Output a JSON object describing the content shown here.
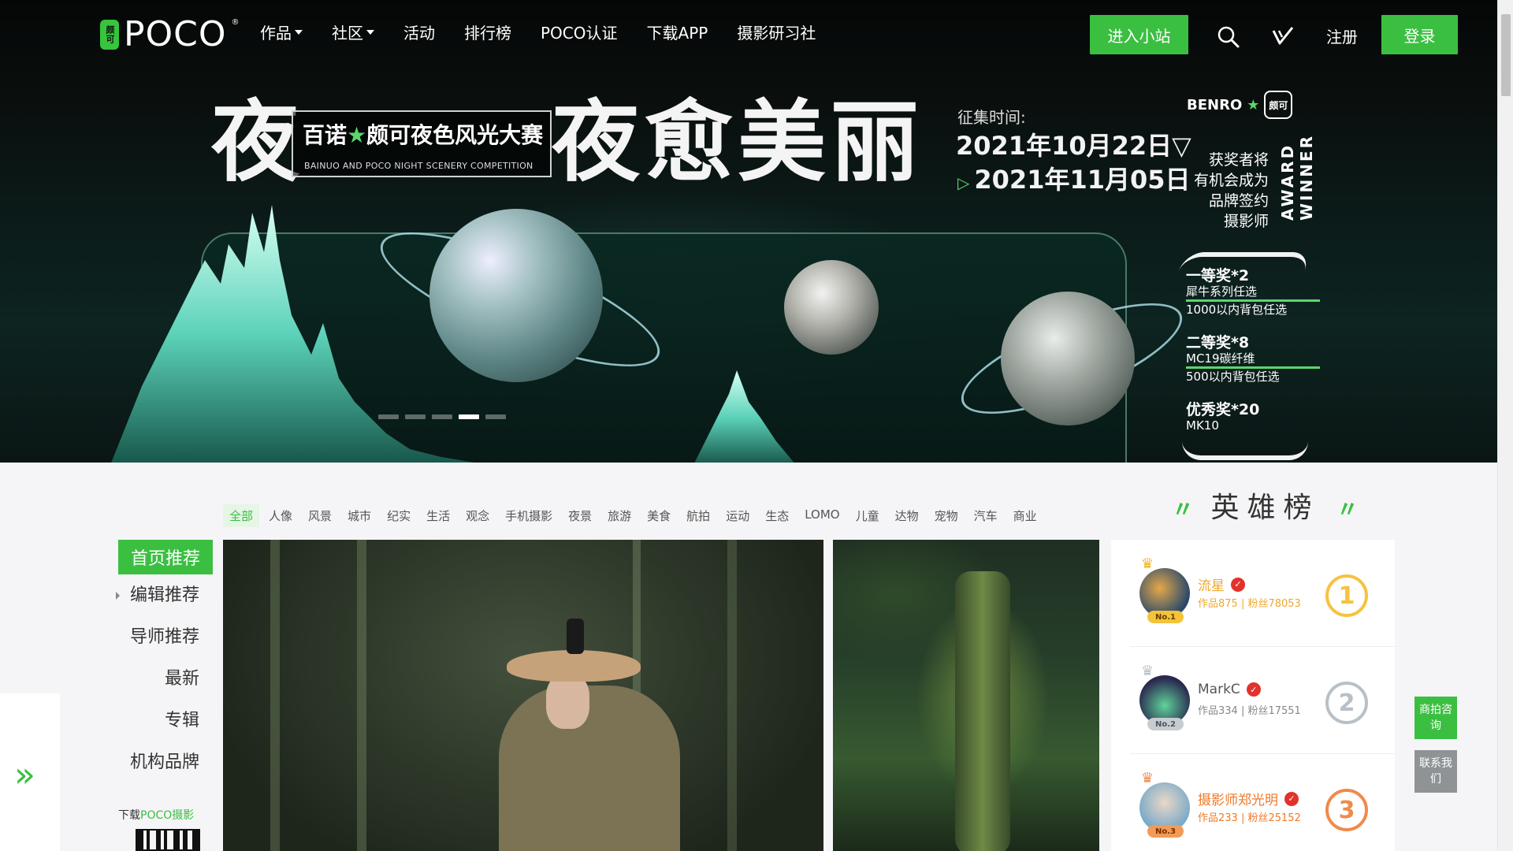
{
  "header": {
    "logo_mark": "颇可",
    "logo_text": "POCO",
    "logo_reg": "®",
    "nav": [
      {
        "label": "作品",
        "has_dropdown": true
      },
      {
        "label": "社区",
        "has_dropdown": true
      },
      {
        "label": "活动",
        "has_dropdown": false
      },
      {
        "label": "排行榜",
        "has_dropdown": false
      },
      {
        "label": "POCO认证",
        "has_dropdown": false
      },
      {
        "label": "下载APP",
        "has_dropdown": false
      },
      {
        "label": "摄影研习社",
        "has_dropdown": false
      }
    ],
    "enter_site": "进入小站",
    "search_icon": "search-icon",
    "check_icon": "check-icon",
    "register": "注册",
    "login": "登录"
  },
  "banner": {
    "title_part1": "夜",
    "title_part2": "夜愈美丽",
    "sub_title_a": "百诺",
    "sub_title_star": "★",
    "sub_title_b": "颇可夜色风光大赛",
    "sub_title_en": "BAINUO AND POCO NIGHT SCENERY COMPETITION",
    "date_label": "征集时间:",
    "date_start": "2021年10月22日▽",
    "date_end_arrow": "▷",
    "date_end": "2021年11月05日",
    "brand": "BENRO",
    "brand_badge": "颇可",
    "winner_lines": [
      "获奖者将",
      "有机会成为",
      "品牌签约",
      "摄影师"
    ],
    "award_winner": "AWARD WINNER",
    "prizes": [
      {
        "name": "一等奖*2",
        "lines": [
          "犀牛系列任选",
          "1000以内背包任选"
        ]
      },
      {
        "name": "二等奖*8",
        "lines": [
          "MC19碳纤维",
          "500以内背包任选"
        ]
      },
      {
        "name": "优秀奖*20",
        "lines": [
          "MK10"
        ]
      }
    ],
    "dots": 5,
    "active_dot": 3
  },
  "categories": [
    "全部",
    "人像",
    "风景",
    "城市",
    "纪实",
    "生活",
    "观念",
    "手机摄影",
    "夜景",
    "旅游",
    "美食",
    "航拍",
    "运动",
    "生态",
    "LOMO",
    "儿童",
    "达物",
    "宠物",
    "汽车",
    "商业"
  ],
  "active_category": "全部",
  "side_menu": {
    "recommend": "首页推荐",
    "items": [
      "编辑推荐",
      "导师推荐",
      "最新",
      "专辑",
      "机构品牌"
    ]
  },
  "download": {
    "prefix": "下载",
    "app": "POCO摄影"
  },
  "hero_board": {
    "title": "英雄榜",
    "quote_left": "〃",
    "quote_right": "〃",
    "items": [
      {
        "name": "流星",
        "stats": "作品875 | 粉丝78053",
        "no": "No.1",
        "rank": "1"
      },
      {
        "name": "MarkC",
        "stats": "作品334 | 粉丝17551",
        "no": "No.2",
        "rank": "2"
      },
      {
        "name": "摄影师郑光明",
        "stats": "作品233 | 粉丝25152",
        "no": "No.3",
        "rank": "3"
      }
    ]
  },
  "float": {
    "consult": "商拍咨询",
    "contact": "联系我们"
  },
  "colors": {
    "accent": "#3bbf41",
    "verified": "#e2322c"
  }
}
